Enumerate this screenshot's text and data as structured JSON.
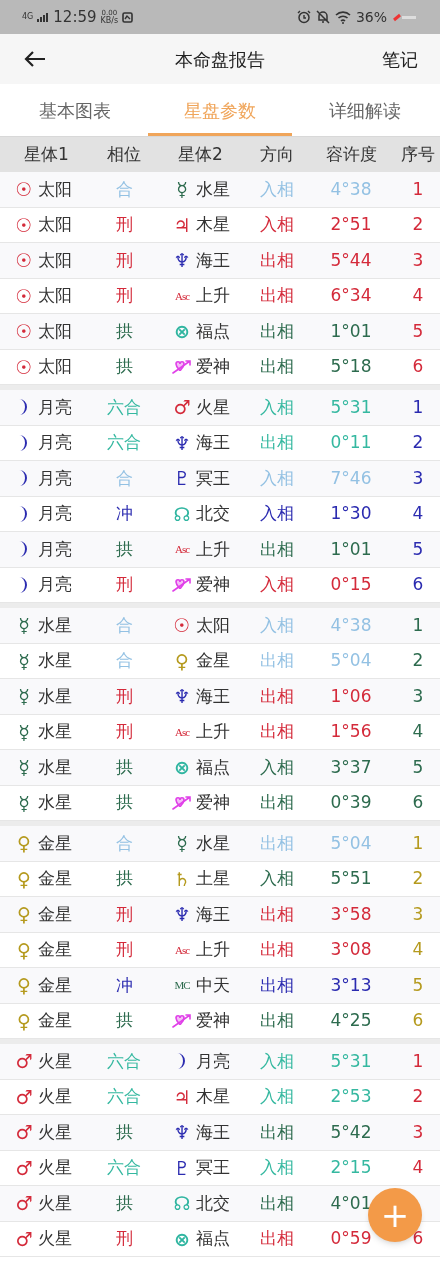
{
  "status_bar": {
    "network": "4G",
    "time": "12:59",
    "speed": "0.00",
    "speed_unit": "KB/s",
    "battery": "36%"
  },
  "header": {
    "title": "本命盘报告",
    "action": "笔记"
  },
  "tabs": [
    {
      "label": "基本图表",
      "selected": false
    },
    {
      "label": "星盘参数",
      "selected": true
    },
    {
      "label": "详细解读",
      "selected": false
    }
  ],
  "table": {
    "columns": [
      "星体1",
      "相位",
      "星体2",
      "方向",
      "容许度",
      "序号"
    ],
    "groups": [
      {
        "rows": [
          {
            "body1": {
              "kind": "glyph",
              "symbol": "☉",
              "name": "太阳",
              "color": "#d42a3a"
            },
            "aspect": "合",
            "color": "#93c1e3",
            "body": {
              "kind": "glyph",
              "symbol": "☿",
              "name": "水星",
              "color": "#2d6b4e"
            },
            "direction": "入相",
            "orb": "4°38",
            "number": "1"
          },
          {
            "body1": {
              "kind": "glyph",
              "symbol": "☉",
              "name": "太阳",
              "color": "#d42a3a"
            },
            "aspect": "刑",
            "color": "#d42a3a",
            "body": {
              "kind": "glyph",
              "symbol": "♃",
              "name": "木星",
              "color": "#d42a3a"
            },
            "direction": "入相",
            "orb": "2°51",
            "number": "2"
          },
          {
            "body1": {
              "kind": "glyph",
              "symbol": "☉",
              "name": "太阳",
              "color": "#d42a3a"
            },
            "aspect": "刑",
            "color": "#d42a3a",
            "body": {
              "kind": "glyph",
              "symbol": "♆",
              "name": "海王",
              "color": "#2b2bb0"
            },
            "direction": "出相",
            "orb": "5°44",
            "number": "3"
          },
          {
            "body1": {
              "kind": "glyph",
              "symbol": "☉",
              "name": "太阳",
              "color": "#d42a3a"
            },
            "aspect": "刑",
            "color": "#d42a3a",
            "body": {
              "kind": "abbr",
              "symbol": "Asc",
              "name": "上升",
              "color": "#d42a3a"
            },
            "direction": "出相",
            "orb": "6°34",
            "number": "4"
          },
          {
            "body1": {
              "kind": "glyph",
              "symbol": "☉",
              "name": "太阳",
              "color": "#d42a3a"
            },
            "aspect": "拱",
            "color": "#2d6b4e",
            "body": {
              "kind": "glyph",
              "symbol": "⊗",
              "name": "福点",
              "color": "#2fb5a0"
            },
            "direction": "出相",
            "orb": "1°01",
            "number": "5"
          },
          {
            "body1": {
              "kind": "glyph",
              "symbol": "☉",
              "name": "太阳",
              "color": "#d42a3a"
            },
            "aspect": "拱",
            "color": "#2d6b4e",
            "body": {
              "kind": "eros",
              "name": "爱神",
              "color": "#e040e8"
            },
            "direction": "出相",
            "orb": "5°18",
            "number": "6"
          }
        ]
      },
      {
        "rows": [
          {
            "body1": {
              "kind": "moon",
              "name": "月亮",
              "color": "#2b2bb0"
            },
            "aspect": "六合",
            "color": "#35b8a0",
            "body": {
              "kind": "glyph",
              "symbol": "♂",
              "name": "火星",
              "color": "#d42a3a"
            },
            "direction": "入相",
            "orb": "5°31",
            "number": "1"
          },
          {
            "body1": {
              "kind": "moon",
              "name": "月亮",
              "color": "#2b2bb0"
            },
            "aspect": "六合",
            "color": "#35b8a0",
            "body": {
              "kind": "glyph",
              "symbol": "♆",
              "name": "海王",
              "color": "#2b2bb0"
            },
            "direction": "出相",
            "orb": "0°11",
            "number": "2"
          },
          {
            "body1": {
              "kind": "moon",
              "name": "月亮",
              "color": "#2b2bb0"
            },
            "aspect": "合",
            "color": "#93c1e3",
            "body": {
              "kind": "glyph",
              "symbol": "♇",
              "name": "冥王",
              "color": "#2b2bb0"
            },
            "direction": "入相",
            "orb": "7°46",
            "number": "3"
          },
          {
            "body1": {
              "kind": "moon",
              "name": "月亮",
              "color": "#2b2bb0"
            },
            "aspect": "冲",
            "color": "#2b2bb0",
            "body": {
              "kind": "glyph",
              "symbol": "☊",
              "name": "北交",
              "color": "#2fb5a0"
            },
            "direction": "入相",
            "orb": "1°30",
            "number": "4"
          },
          {
            "body1": {
              "kind": "moon",
              "name": "月亮",
              "color": "#2b2bb0"
            },
            "aspect": "拱",
            "color": "#2d6b4e",
            "body": {
              "kind": "abbr",
              "symbol": "Asc",
              "name": "上升",
              "color": "#d42a3a"
            },
            "direction": "出相",
            "orb": "1°01",
            "number": "5"
          },
          {
            "body1": {
              "kind": "moon",
              "name": "月亮",
              "color": "#2b2bb0"
            },
            "aspect": "刑",
            "color": "#d42a3a",
            "body": {
              "kind": "eros",
              "name": "爱神",
              "color": "#e040e8"
            },
            "direction": "入相",
            "orb": "0°15",
            "number": "6"
          }
        ]
      },
      {
        "rows": [
          {
            "body1": {
              "kind": "glyph",
              "symbol": "☿",
              "name": "水星",
              "color": "#2d6b4e"
            },
            "aspect": "合",
            "color": "#93c1e3",
            "body": {
              "kind": "glyph",
              "symbol": "☉",
              "name": "太阳",
              "color": "#d42a3a"
            },
            "direction": "入相",
            "orb": "4°38",
            "number": "1"
          },
          {
            "body1": {
              "kind": "glyph",
              "symbol": "☿",
              "name": "水星",
              "color": "#2d6b4e"
            },
            "aspect": "合",
            "color": "#93c1e3",
            "body": {
              "kind": "glyph",
              "symbol": "♀",
              "name": "金星",
              "color": "#b59a1e"
            },
            "direction": "出相",
            "orb": "5°04",
            "number": "2"
          },
          {
            "body1": {
              "kind": "glyph",
              "symbol": "☿",
              "name": "水星",
              "color": "#2d6b4e"
            },
            "aspect": "刑",
            "color": "#d42a3a",
            "body": {
              "kind": "glyph",
              "symbol": "♆",
              "name": "海王",
              "color": "#2b2bb0"
            },
            "direction": "出相",
            "orb": "1°06",
            "number": "3"
          },
          {
            "body1": {
              "kind": "glyph",
              "symbol": "☿",
              "name": "水星",
              "color": "#2d6b4e"
            },
            "aspect": "刑",
            "color": "#d42a3a",
            "body": {
              "kind": "abbr",
              "symbol": "Asc",
              "name": "上升",
              "color": "#d42a3a"
            },
            "direction": "出相",
            "orb": "1°56",
            "number": "4"
          },
          {
            "body1": {
              "kind": "glyph",
              "symbol": "☿",
              "name": "水星",
              "color": "#2d6b4e"
            },
            "aspect": "拱",
            "color": "#2d6b4e",
            "body": {
              "kind": "glyph",
              "symbol": "⊗",
              "name": "福点",
              "color": "#2fb5a0"
            },
            "direction": "入相",
            "orb": "3°37",
            "number": "5"
          },
          {
            "body1": {
              "kind": "glyph",
              "symbol": "☿",
              "name": "水星",
              "color": "#2d6b4e"
            },
            "aspect": "拱",
            "color": "#2d6b4e",
            "body": {
              "kind": "eros",
              "name": "爱神",
              "color": "#e040e8"
            },
            "direction": "出相",
            "orb": "0°39",
            "number": "6"
          }
        ]
      },
      {
        "rows": [
          {
            "body1": {
              "kind": "glyph",
              "symbol": "♀",
              "name": "金星",
              "color": "#b59a1e"
            },
            "aspect": "合",
            "color": "#93c1e3",
            "body": {
              "kind": "glyph",
              "symbol": "☿",
              "name": "水星",
              "color": "#2d6b4e"
            },
            "direction": "出相",
            "orb": "5°04",
            "number": "1"
          },
          {
            "body1": {
              "kind": "glyph",
              "symbol": "♀",
              "name": "金星",
              "color": "#b59a1e"
            },
            "aspect": "拱",
            "color": "#2d6b4e",
            "body": {
              "kind": "glyph",
              "symbol": "♄",
              "name": "土星",
              "color": "#b59a1e"
            },
            "direction": "入相",
            "orb": "5°51",
            "number": "2"
          },
          {
            "body1": {
              "kind": "glyph",
              "symbol": "♀",
              "name": "金星",
              "color": "#b59a1e"
            },
            "aspect": "刑",
            "color": "#d42a3a",
            "body": {
              "kind": "glyph",
              "symbol": "♆",
              "name": "海王",
              "color": "#2b2bb0"
            },
            "direction": "出相",
            "orb": "3°58",
            "number": "3"
          },
          {
            "body1": {
              "kind": "glyph",
              "symbol": "♀",
              "name": "金星",
              "color": "#b59a1e"
            },
            "aspect": "刑",
            "color": "#d42a3a",
            "body": {
              "kind": "abbr",
              "symbol": "Asc",
              "name": "上升",
              "color": "#d42a3a"
            },
            "direction": "出相",
            "orb": "3°08",
            "number": "4"
          },
          {
            "body1": {
              "kind": "glyph",
              "symbol": "♀",
              "name": "金星",
              "color": "#b59a1e"
            },
            "aspect": "冲",
            "color": "#2b2bb0",
            "body": {
              "kind": "abbr",
              "symbol": "MC",
              "name": "中天",
              "color": "#2d6b4e"
            },
            "direction": "出相",
            "orb": "3°13",
            "number": "5"
          },
          {
            "body1": {
              "kind": "glyph",
              "symbol": "♀",
              "name": "金星",
              "color": "#b59a1e"
            },
            "aspect": "拱",
            "color": "#2d6b4e",
            "body": {
              "kind": "eros",
              "name": "爱神",
              "color": "#e040e8"
            },
            "direction": "出相",
            "orb": "4°25",
            "number": "6"
          }
        ]
      },
      {
        "rows": [
          {
            "body1": {
              "kind": "glyph",
              "symbol": "♂",
              "name": "火星",
              "color": "#d42a3a"
            },
            "aspect": "六合",
            "color": "#35b8a0",
            "body": {
              "kind": "moon",
              "name": "月亮",
              "color": "#2b2bb0"
            },
            "direction": "入相",
            "orb": "5°31",
            "number": "1"
          },
          {
            "body1": {
              "kind": "glyph",
              "symbol": "♂",
              "name": "火星",
              "color": "#d42a3a"
            },
            "aspect": "六合",
            "color": "#35b8a0",
            "body": {
              "kind": "glyph",
              "symbol": "♃",
              "name": "木星",
              "color": "#d42a3a"
            },
            "direction": "入相",
            "orb": "2°53",
            "number": "2"
          },
          {
            "body1": {
              "kind": "glyph",
              "symbol": "♂",
              "name": "火星",
              "color": "#d42a3a"
            },
            "aspect": "拱",
            "color": "#2d6b4e",
            "body": {
              "kind": "glyph",
              "symbol": "♆",
              "name": "海王",
              "color": "#2b2bb0"
            },
            "direction": "出相",
            "orb": "5°42",
            "number": "3"
          },
          {
            "body1": {
              "kind": "glyph",
              "symbol": "♂",
              "name": "火星",
              "color": "#d42a3a"
            },
            "aspect": "六合",
            "color": "#35b8a0",
            "body": {
              "kind": "glyph",
              "symbol": "♇",
              "name": "冥王",
              "color": "#2b2bb0"
            },
            "direction": "入相",
            "orb": "2°15",
            "number": "4"
          },
          {
            "body1": {
              "kind": "glyph",
              "symbol": "♂",
              "name": "火星",
              "color": "#d42a3a"
            },
            "aspect": "拱",
            "color": "#2d6b4e",
            "body": {
              "kind": "glyph",
              "symbol": "☊",
              "name": "北交",
              "color": "#2fb5a0"
            },
            "direction": "出相",
            "orb": "4°01"
          },
          {
            "body1": {
              "kind": "glyph",
              "symbol": "♂",
              "name": "火星",
              "color": "#d42a3a"
            },
            "aspect": "刑",
            "color": "#d42a3a",
            "body": {
              "kind": "glyph",
              "symbol": "⊗",
              "name": "福点",
              "color": "#2fb5a0"
            },
            "direction": "出相",
            "orb": "0°59",
            "number": "6"
          }
        ]
      }
    ]
  },
  "fab": {
    "symbol": "+"
  }
}
